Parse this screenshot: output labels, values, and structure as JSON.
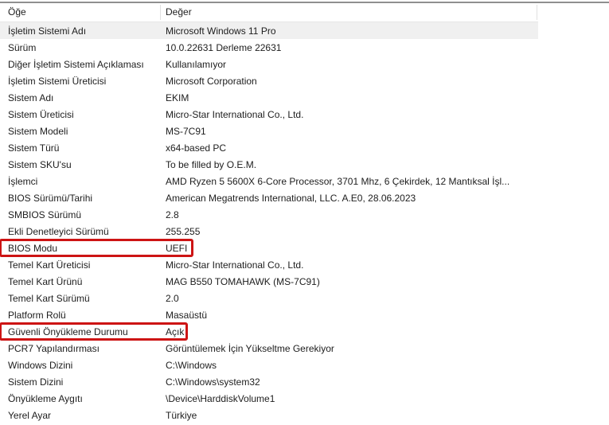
{
  "colors": {
    "annotation_red": "#cd1414",
    "selected_row_bg": "#f0f0f0",
    "header_top_line": "#8f8f8f",
    "header_divider": "#e0e0e0"
  },
  "table": {
    "columns": [
      "Öğe",
      "Değer"
    ],
    "rows": [
      {
        "label": "İşletim Sistemi Adı",
        "value": "Microsoft Windows 11 Pro",
        "selected": true
      },
      {
        "label": "Sürüm",
        "value": "10.0.22631 Derleme 22631"
      },
      {
        "label": "Diğer İşletim Sistemi Açıklaması",
        "value": "Kullanılamıyor"
      },
      {
        "label": "İşletim Sistemi Üreticisi",
        "value": "Microsoft Corporation"
      },
      {
        "label": "Sistem Adı",
        "value": "EKIM"
      },
      {
        "label": "Sistem Üreticisi",
        "value": "Micro-Star International Co., Ltd."
      },
      {
        "label": "Sistem Modeli",
        "value": "MS-7C91"
      },
      {
        "label": "Sistem Türü",
        "value": "x64-based PC"
      },
      {
        "label": "Sistem SKU'su",
        "value": "To be filled by O.E.M."
      },
      {
        "label": "İşlemci",
        "value": "AMD Ryzen 5 5600X 6-Core Processor, 3701 Mhz, 6 Çekirdek, 12 Mantıksal İşl..."
      },
      {
        "label": "BIOS Sürümü/Tarihi",
        "value": "American Megatrends International, LLC. A.E0, 28.06.2023"
      },
      {
        "label": "SMBIOS Sürümü",
        "value": "2.8"
      },
      {
        "label": "Ekli Denetleyici Sürümü",
        "value": "255.255"
      },
      {
        "label": "BIOS Modu",
        "value": "UEFI",
        "red_box": true,
        "red_box_width": 244
      },
      {
        "label": "Temel Kart Üreticisi",
        "value": "Micro-Star International Co., Ltd."
      },
      {
        "label": "Temel Kart Ürünü",
        "value": "MAG B550 TOMAHAWK (MS-7C91)"
      },
      {
        "label": "Temel Kart Sürümü",
        "value": "2.0"
      },
      {
        "label": "Platform Rolü",
        "value": "Masaüstü"
      },
      {
        "label": "Güvenli Önyükleme Durumu",
        "value": "Açık",
        "red_box": true,
        "red_box_width": 237
      },
      {
        "label": "PCR7 Yapılandırması",
        "value": "Görüntülemek İçin Yükseltme Gerekiyor"
      },
      {
        "label": "Windows Dizini",
        "value": "C:\\Windows"
      },
      {
        "label": "Sistem Dizini",
        "value": "C:\\Windows\\system32"
      },
      {
        "label": "Önyükleme Aygıtı",
        "value": "\\Device\\HarddiskVolume1"
      },
      {
        "label": "Yerel Ayar",
        "value": "Türkiye"
      }
    ]
  }
}
